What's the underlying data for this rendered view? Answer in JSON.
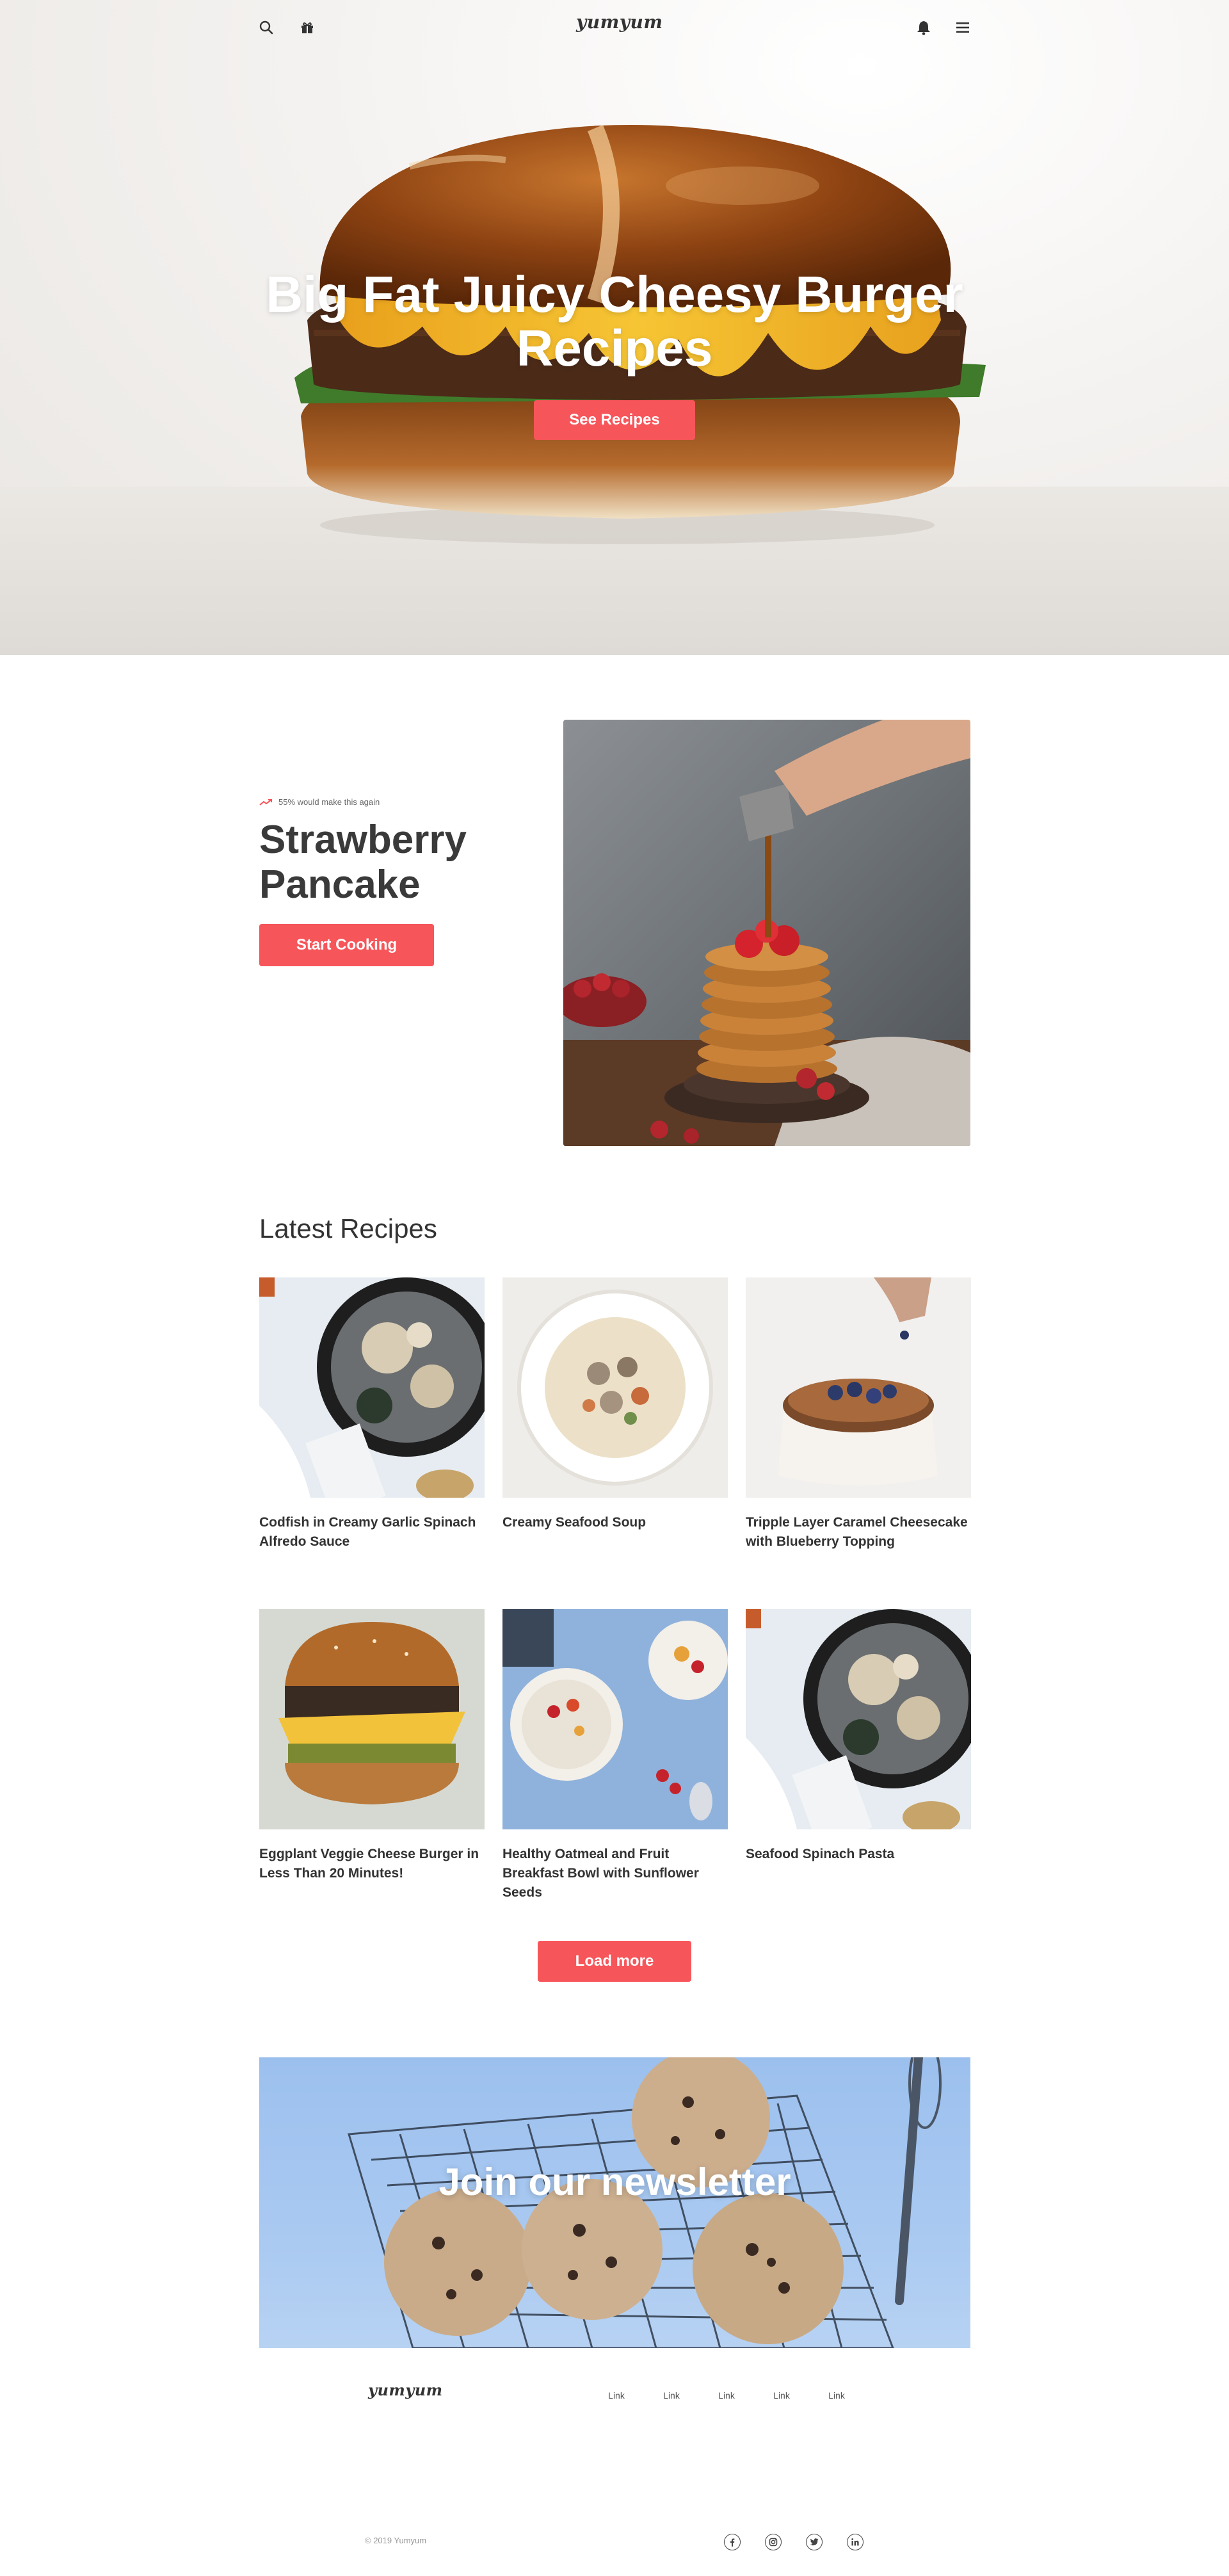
{
  "header": {
    "logo": "yumyum",
    "icons": [
      "search-icon",
      "gift-icon",
      "bell-icon",
      "menu-icon"
    ]
  },
  "hero": {
    "title": "Big Fat Juicy Cheesy Burger Recipes",
    "button_label": "See Recipes"
  },
  "featured": {
    "rating_text": "55% would make this again",
    "title": "Strawberry Pancake",
    "button_label": "Start Cooking"
  },
  "latest": {
    "heading": "Latest Recipes",
    "recipes": [
      {
        "title": "Codfish in Creamy Garlic Spinach Alfredo Sauce"
      },
      {
        "title": "Creamy Seafood Soup"
      },
      {
        "title": "Tripple Layer Caramel Cheesecake with Blueberry Topping"
      },
      {
        "title": "Eggplant Veggie Cheese Burger in Less Than 20 Minutes!"
      },
      {
        "title": "Healthy Oatmeal and Fruit Breakfast Bowl with Sunflower Seeds"
      },
      {
        "title": "Seafood Spinach Pasta"
      }
    ],
    "load_more_label": "Load more"
  },
  "newsletter": {
    "title": "Join our newsletter"
  },
  "footer": {
    "logo": "yumyum",
    "links": [
      "Link",
      "Link",
      "Link",
      "Link",
      "Link"
    ],
    "copyright": "© 2019 Yumyum",
    "socials": [
      "facebook-icon",
      "instagram-icon",
      "twitter-icon",
      "linkedin-icon"
    ]
  },
  "colors": {
    "accent": "#f6555a",
    "text": "#333333",
    "newsletter_bg": "#a9c9f1"
  }
}
